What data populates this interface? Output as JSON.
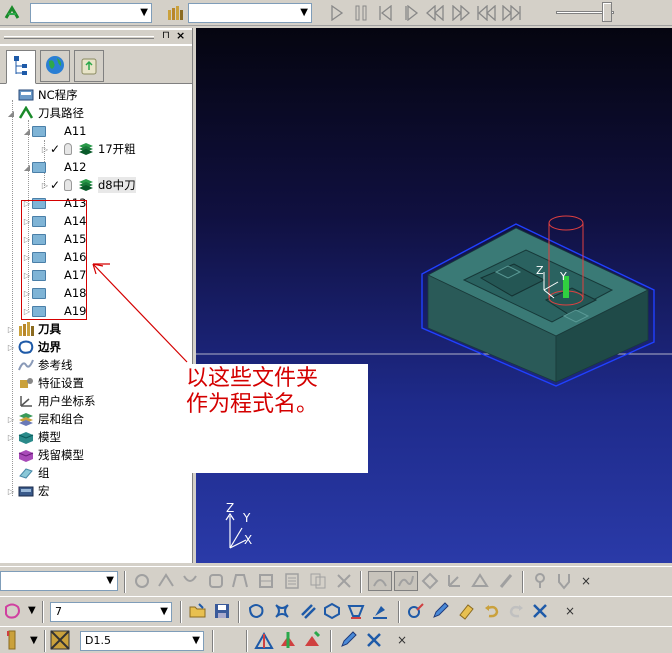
{
  "top_toolbar": {
    "combo1_value": "",
    "combo2_value": ""
  },
  "explorer": {
    "tabs": [
      {
        "icon": "tree-icon"
      },
      {
        "icon": "globe-icon"
      },
      {
        "icon": "recycle-bin-icon"
      }
    ],
    "tree": {
      "nc_programs": "NC程序",
      "toolpaths": "刀具路径",
      "folders": {
        "a11": "A11",
        "a11_child": "17开粗",
        "a12": "A12",
        "a12_child": "d8中刀",
        "a13": "A13",
        "a14": "A14",
        "a15": "A15",
        "a16": "A16",
        "a17": "A17",
        "a18": "A18",
        "a19": "A19"
      },
      "tools": "刀具",
      "boundaries": "边界",
      "reference_lines": "参考线",
      "feature_settings": "特征设置",
      "user_coordinate_systems": "用户坐标系",
      "levels_and_sets": "层和组合",
      "model": "模型",
      "stock_model": "残留模型",
      "groups": "组",
      "macro": "宏"
    }
  },
  "annotation": {
    "text_line1": "以这些文件夹",
    "text_line2": "作为程式名。"
  },
  "viewport": {
    "axis_z": "Z",
    "axis_y": "Y",
    "axis_x": "X",
    "tool_axis_z": "Z",
    "tool_axis_y": "Y"
  },
  "bottom_toolbar_2": {
    "value": "7"
  },
  "bottom_toolbar_3": {
    "value": "D1.5"
  },
  "colors": {
    "annotation_red": "#d40000",
    "viewport_top": "#050510",
    "viewport_bottom": "#2a3aa8",
    "model_green": "#3a7a76"
  }
}
